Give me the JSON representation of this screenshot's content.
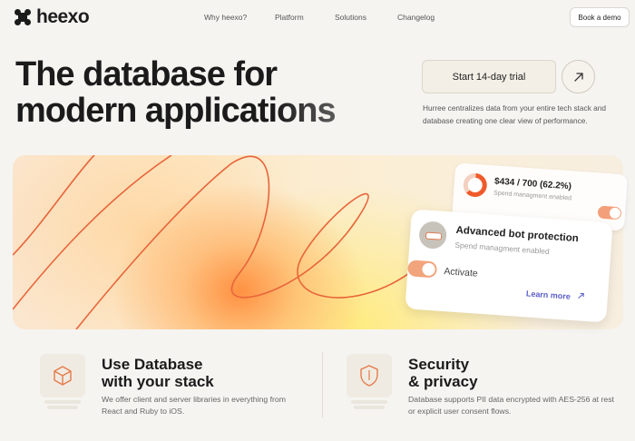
{
  "brand": {
    "name": "heexo",
    "accent": "#f05a2a"
  },
  "nav": {
    "links": [
      "Why heexo?",
      "Platform",
      "Solutions",
      "Changelog"
    ],
    "cta": "Book a demo"
  },
  "hero": {
    "title_line1": "The database for",
    "title_line2": "modern applications",
    "trial_button": "Start 14-day trial",
    "description": "Hurree centralizes data from your entire tech stack and database creating one clear view of performance."
  },
  "banner": {
    "spend_card": {
      "amount": "$434 / 700 (62.2%)",
      "subtitle": "Spend managment enabled",
      "progress": 0.622
    },
    "bot_card": {
      "title": "Advanced bot protection",
      "subtitle": "Spend managment enabled",
      "toggle_label": "Activate",
      "link": "Learn more"
    }
  },
  "features": [
    {
      "icon": "cube-icon",
      "title_line1": "Use Database",
      "title_line2": "with your stack",
      "description": "We offer client and server libraries in everything from React and Ruby to iOS."
    },
    {
      "icon": "shield-icon",
      "title_line1": "Security",
      "title_line2": "& privacy",
      "description": "Database supports PII data encrypted with AES-256 at rest or explicit user consent flows."
    }
  ]
}
